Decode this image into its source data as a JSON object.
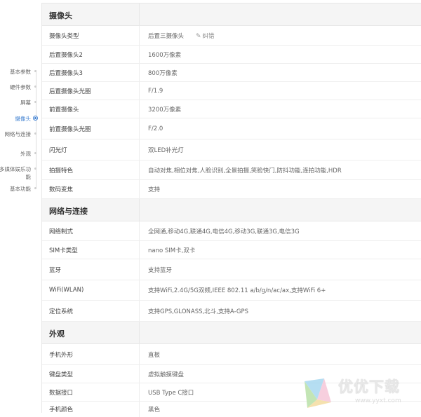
{
  "nav": {
    "items": [
      {
        "label": "基本参数"
      },
      {
        "label": "硬件参数"
      },
      {
        "label": "屏幕"
      },
      {
        "label": "摄像头",
        "active": true
      },
      {
        "label": "网络与连接"
      },
      {
        "label": "外观"
      },
      {
        "label": "多媒体娱乐功能"
      },
      {
        "label": "基本功能"
      }
    ]
  },
  "sections": [
    {
      "title": "摄像头",
      "rows": [
        {
          "label": "摄像头类型",
          "value": "后置三摄像头",
          "correct": "纠错"
        },
        {
          "label": "后置摄像头2",
          "value": "1600万像素"
        },
        {
          "label": "后置摄像头3",
          "value": "800万像素"
        },
        {
          "label": "后置摄像头光圈",
          "value": "F/1.9"
        },
        {
          "label": "前置摄像头",
          "value": "3200万像素"
        },
        {
          "label": "前置摄像头光圈",
          "value": "F/2.0"
        },
        {
          "label": "闪光灯",
          "value": "双LED补光灯"
        },
        {
          "label": "拍摄特色",
          "value": "自动对焦,相位对焦,人脸识别,全景拍摄,笑脸快门,防抖功能,连拍功能,HDR"
        },
        {
          "label": "数码变焦",
          "value": "支持"
        }
      ]
    },
    {
      "title": "网络与连接",
      "rows": [
        {
          "label": "网络制式",
          "value": "全网通,移动4G,联通4G,电信4G,移动3G,联通3G,电信3G"
        },
        {
          "label": "SIM卡类型",
          "value": "nano SIM卡,双卡"
        },
        {
          "label": "蓝牙",
          "value": "支持蓝牙"
        },
        {
          "label": "WiFi(WLAN)",
          "value": "支持WiFi,2.4G/5G双频,IEEE 802.11 a/b/g/n/ac/ax,支持WiFi 6+"
        },
        {
          "label": "定位系统",
          "value": "支持GPS,GLONASS,北斗,支持A-GPS"
        }
      ]
    },
    {
      "title": "外观",
      "rows": [
        {
          "label": "手机外形",
          "value": "直板"
        },
        {
          "label": "键盘类型",
          "value": "虚拟触摸键盘"
        },
        {
          "label": "数据接口",
          "value": "USB Type C接口"
        },
        {
          "label": "手机颜色",
          "value": "黑色"
        }
      ]
    }
  ],
  "watermark": {
    "text": "优优下载",
    "url": "www.yyxt.com"
  },
  "colors": {
    "accent": "#3d7fd0",
    "header_bg": "#f5f5f5",
    "border": "#e8e8e8"
  },
  "icons": {
    "correct": "pencil-icon",
    "active_nav": "radio-dot-icon",
    "watermark": "logo-icon"
  }
}
